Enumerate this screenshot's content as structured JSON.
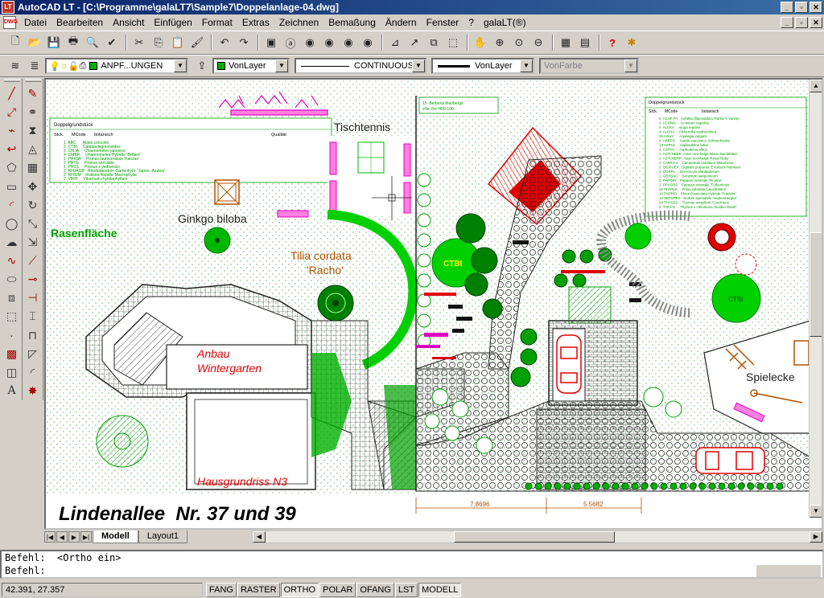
{
  "window": {
    "title": "AutoCAD LT - [C:\\Programme\\galaLT7\\Sample7\\Doppelanlage-04.dwg]",
    "controls": [
      "_",
      "▫",
      "✕"
    ]
  },
  "menu": {
    "items": [
      "Datei",
      "Bearbeiten",
      "Ansicht",
      "Einfügen",
      "Format",
      "Extras",
      "Zeichnen",
      "Bemaßung",
      "Ändern",
      "Fenster",
      "?",
      "galaLT(®)"
    ]
  },
  "properties_toolbar": {
    "layer": "ANPF...UNGEN",
    "color": "VonLayer",
    "linetype": "CONTINUOUS",
    "lineweight": "VonLayer",
    "plotstyle": "VonFarbe",
    "colors": {
      "layer_swatch": "#00b000",
      "color_swatch": "#00b000"
    }
  },
  "drawing": {
    "labels": {
      "tischtennis": "Tischtennis",
      "ginkgo": "Ginkgo biloba",
      "tilia": "Tilia cordata",
      "racho": "'Racho'",
      "rasen": "Rasenfläche",
      "anbau1": "Anbau",
      "anbau2": "Wintergarten",
      "hausgrundriss": "Hausgrundriss N3",
      "spielecke": "Spielecke",
      "title": "Lindenallee  Nr. 37 und 39",
      "ctbi_left": "CTBI",
      "ctbi_right": "CTBI",
      "dim1": "7.8696",
      "dim2": "5.5682"
    },
    "plant_list_left": {
      "heading": "Doppelgrundstück",
      "columns": [
        "Stck.",
        "MCode",
        "botanisch",
        "Qualität"
      ],
      "rows": [
        "1  ABC      Abies concolor",
        "2  CTBI     Catalpa bignonioides",
        "3  CMJA     Chaenomeles japonica",
        "4  CMBR     Chaenomeles-Hybride 'Brillant'",
        "1  PRKSK    Prunus laurocerasus 'Kanzan'",
        "2  PRYE     Prunus serrulata",
        "1  PRO1     Prunus x yedoensis",
        "2  RHJAGB   Rhododendron Gartenhybr. 'Japon.-Azalea'",
        "2  RHSIM    Robinia hispida 'Macrophylla'",
        "2  VIRH     Viburnum rhytidophyllum"
      ]
    },
    "plant_list_right": {
      "heading": "Doppelgrundstück",
      "columns": [
        "Stck.",
        "MCode",
        "botanisch"
      ],
      "rows": [
        "5  ACHF PY   Achillea filipendulina 'Parker's Variety'",
        "2  ACONN     Aconitum napellus",
        "4  ALCK4     Ajuga reptans",
        "4  ALCHA     Alchemilla xanthochlora",
        "35 AGUY      Aquilegia vulgaris",
        "4  ARECS     Arabis caucasica 'Schneehaube'",
        "13 ASPHL     Asphodeline lutea",
        "3  ASPHA     Asphodelus albus",
        "1  ASTLNBBR  Aster novi-belgii 'Blaue Nachtfalter'",
        "1  ASTLNBRR  Aster novi-belgii 'Royal Ruby'",
        "2  CAMCAS    Campanula carpatica 'Blaumeise'",
        "2  DIGPUEX   Digitalis purpurea 'Excelsior-Hybriden'",
        "2  DORPL     Doronicum plantagineum",
        "1  GERSSC    Geranium sanguineum",
        "2  PAPORI    Papaver orientale 'Picotee'",
        "2  PPVGRS    Papaver orientale 'Türkenlouis'",
        "32 PHXSUL    Phlox subulata 'Lauchblüten'",
        "10 PXPRFI    Phlox-Paniculata-Hybride 'Fräulein'",
        "13 SEPSPES   Sedum spectabile 'Septemberglut'",
        "24 THYSEC    Thymus serpyllum 'Coccineus'",
        "4  THYCO     Thymus x citriodorus 'Golden Dwarf'"
      ]
    },
    "legend_box": {
      "line1": "15  Berberis thunbergii",
      "line2": "vHe 2xv H50-100"
    }
  },
  "tabs": {
    "model": "Modell",
    "layout": "Layout1"
  },
  "command": {
    "line1": "Befehl:  <Ortho ein>",
    "line2": "Befehl:"
  },
  "status": {
    "coords": "42.391, 27.357",
    "buttons": [
      {
        "label": "FANG",
        "on": false
      },
      {
        "label": "RASTER",
        "on": false
      },
      {
        "label": "ORTHO",
        "on": true
      },
      {
        "label": "POLAR",
        "on": false
      },
      {
        "label": "OFANG",
        "on": false
      },
      {
        "label": "LST",
        "on": false
      },
      {
        "label": "MODELL",
        "on": true
      }
    ]
  }
}
